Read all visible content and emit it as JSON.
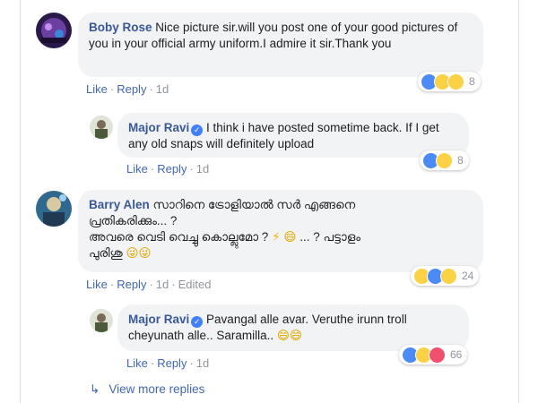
{
  "comments": [
    {
      "name": "Boby Rose",
      "text": "Nice picture sir.will you post one of your good pictures of you in your official army uniform.I admire it sir.Thank you",
      "like": "Like",
      "reply": "Reply",
      "time": "1d",
      "reactions": [
        "like-icon",
        "haha-icon",
        "sad-icon"
      ],
      "reaction_count": "8",
      "reply_item": {
        "name": "Major Ravi",
        "text": "I think i have posted sometime back. If I get any old snaps will definitely upload",
        "like": "Like",
        "reply": "Reply",
        "time": "1d",
        "reactions": [
          "like-icon",
          "haha-icon"
        ],
        "reaction_count": "8"
      }
    },
    {
      "name": "Barry Alen",
      "text_line1": "സാറിനെ ട്രോളിയാൽ സർ എങ്ങനെ",
      "text_line2": "പ്രതികരിക്കും... ?",
      "text_line3_a": "അവരെ വെടി വെച്ചു കൊല്ലുമോ ?",
      "text_line3_b": "... ? പട്ടാളം",
      "text_line4": "പുരിശു",
      "like": "Like",
      "reply": "Reply",
      "time": "1d",
      "edited": "Edited",
      "reactions": [
        "haha-icon",
        "like-icon",
        "sad-icon"
      ],
      "reaction_count": "24",
      "reply_item": {
        "name": "Major Ravi",
        "text": "Pavangal alle avar. Veruthe irunn troll cheyunath alle.. Saramilla..",
        "like": "Like",
        "reply": "Reply",
        "time": "1d",
        "reactions": [
          "like-icon",
          "haha-icon",
          "love-icon"
        ],
        "reaction_count": "66"
      }
    }
  ],
  "view_more": "View more replies",
  "colors": {
    "name": "#385898",
    "link": "#4267b2",
    "bubble": "#f2f3f5",
    "meta": "#90949c"
  }
}
